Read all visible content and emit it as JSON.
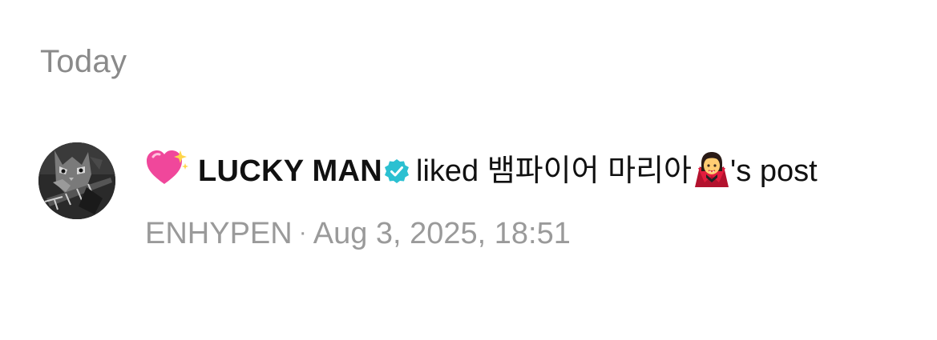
{
  "section": {
    "title": "Today"
  },
  "notification": {
    "avatar_icon": "cat-guitar-avatar",
    "leading_icon": "sparkling-heart-icon",
    "username": "LUCKY MAN",
    "verified_icon": "verified-badge-icon",
    "action": "liked",
    "target_name": "뱀파이어 마리아",
    "target_emoji_icon": "woman-vampire-icon",
    "suffix": "'s",
    "object": "post",
    "community": "ENHYPEN",
    "separator": "·",
    "timestamp": "Aug 3, 2025, 18:51"
  },
  "colors": {
    "heart": "#f0479b",
    "verified": "#2bc0d1",
    "meta_text": "#9a9a9a",
    "header_text": "#8a8a8a"
  }
}
